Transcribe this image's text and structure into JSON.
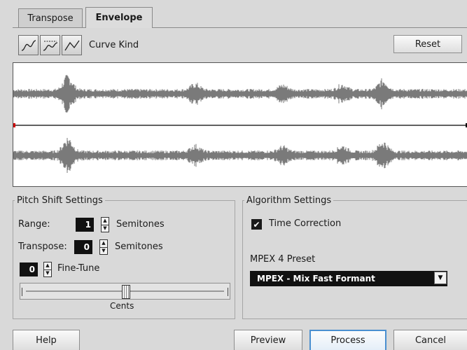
{
  "tabs": [
    {
      "label": "Transpose",
      "active": false
    },
    {
      "label": "Envelope",
      "active": true
    }
  ],
  "toolbar": {
    "curve_kind_label": "Curve Kind",
    "reset_label": "Reset",
    "curve_buttons": [
      "spline-curve-icon",
      "damped-spline-curve-icon",
      "linear-curve-icon"
    ]
  },
  "pitch_shift": {
    "title": "Pitch Shift Settings",
    "range_label": "Range:",
    "range_value": "1",
    "range_unit": "Semitones",
    "transpose_label": "Transpose:",
    "transpose_value": "0",
    "transpose_unit": "Semitones",
    "finetune_value": "0",
    "finetune_label": "Fine-Tune",
    "slider_caption": "Cents",
    "slider_level": 0.5
  },
  "algorithm": {
    "title": "Algorithm Settings",
    "time_correction_label": "Time Correction",
    "time_correction_checked": true,
    "preset_label": "MPEX 4 Preset",
    "preset_value": "MPEX - Mix Fast Formant"
  },
  "footer": {
    "help_label": "Help",
    "preview_label": "Preview",
    "process_label": "Process",
    "cancel_label": "Cancel"
  },
  "colors": {
    "waveform": "#7a7a7a",
    "envelope_line": "#000000",
    "envelope_point": "#d00000"
  }
}
